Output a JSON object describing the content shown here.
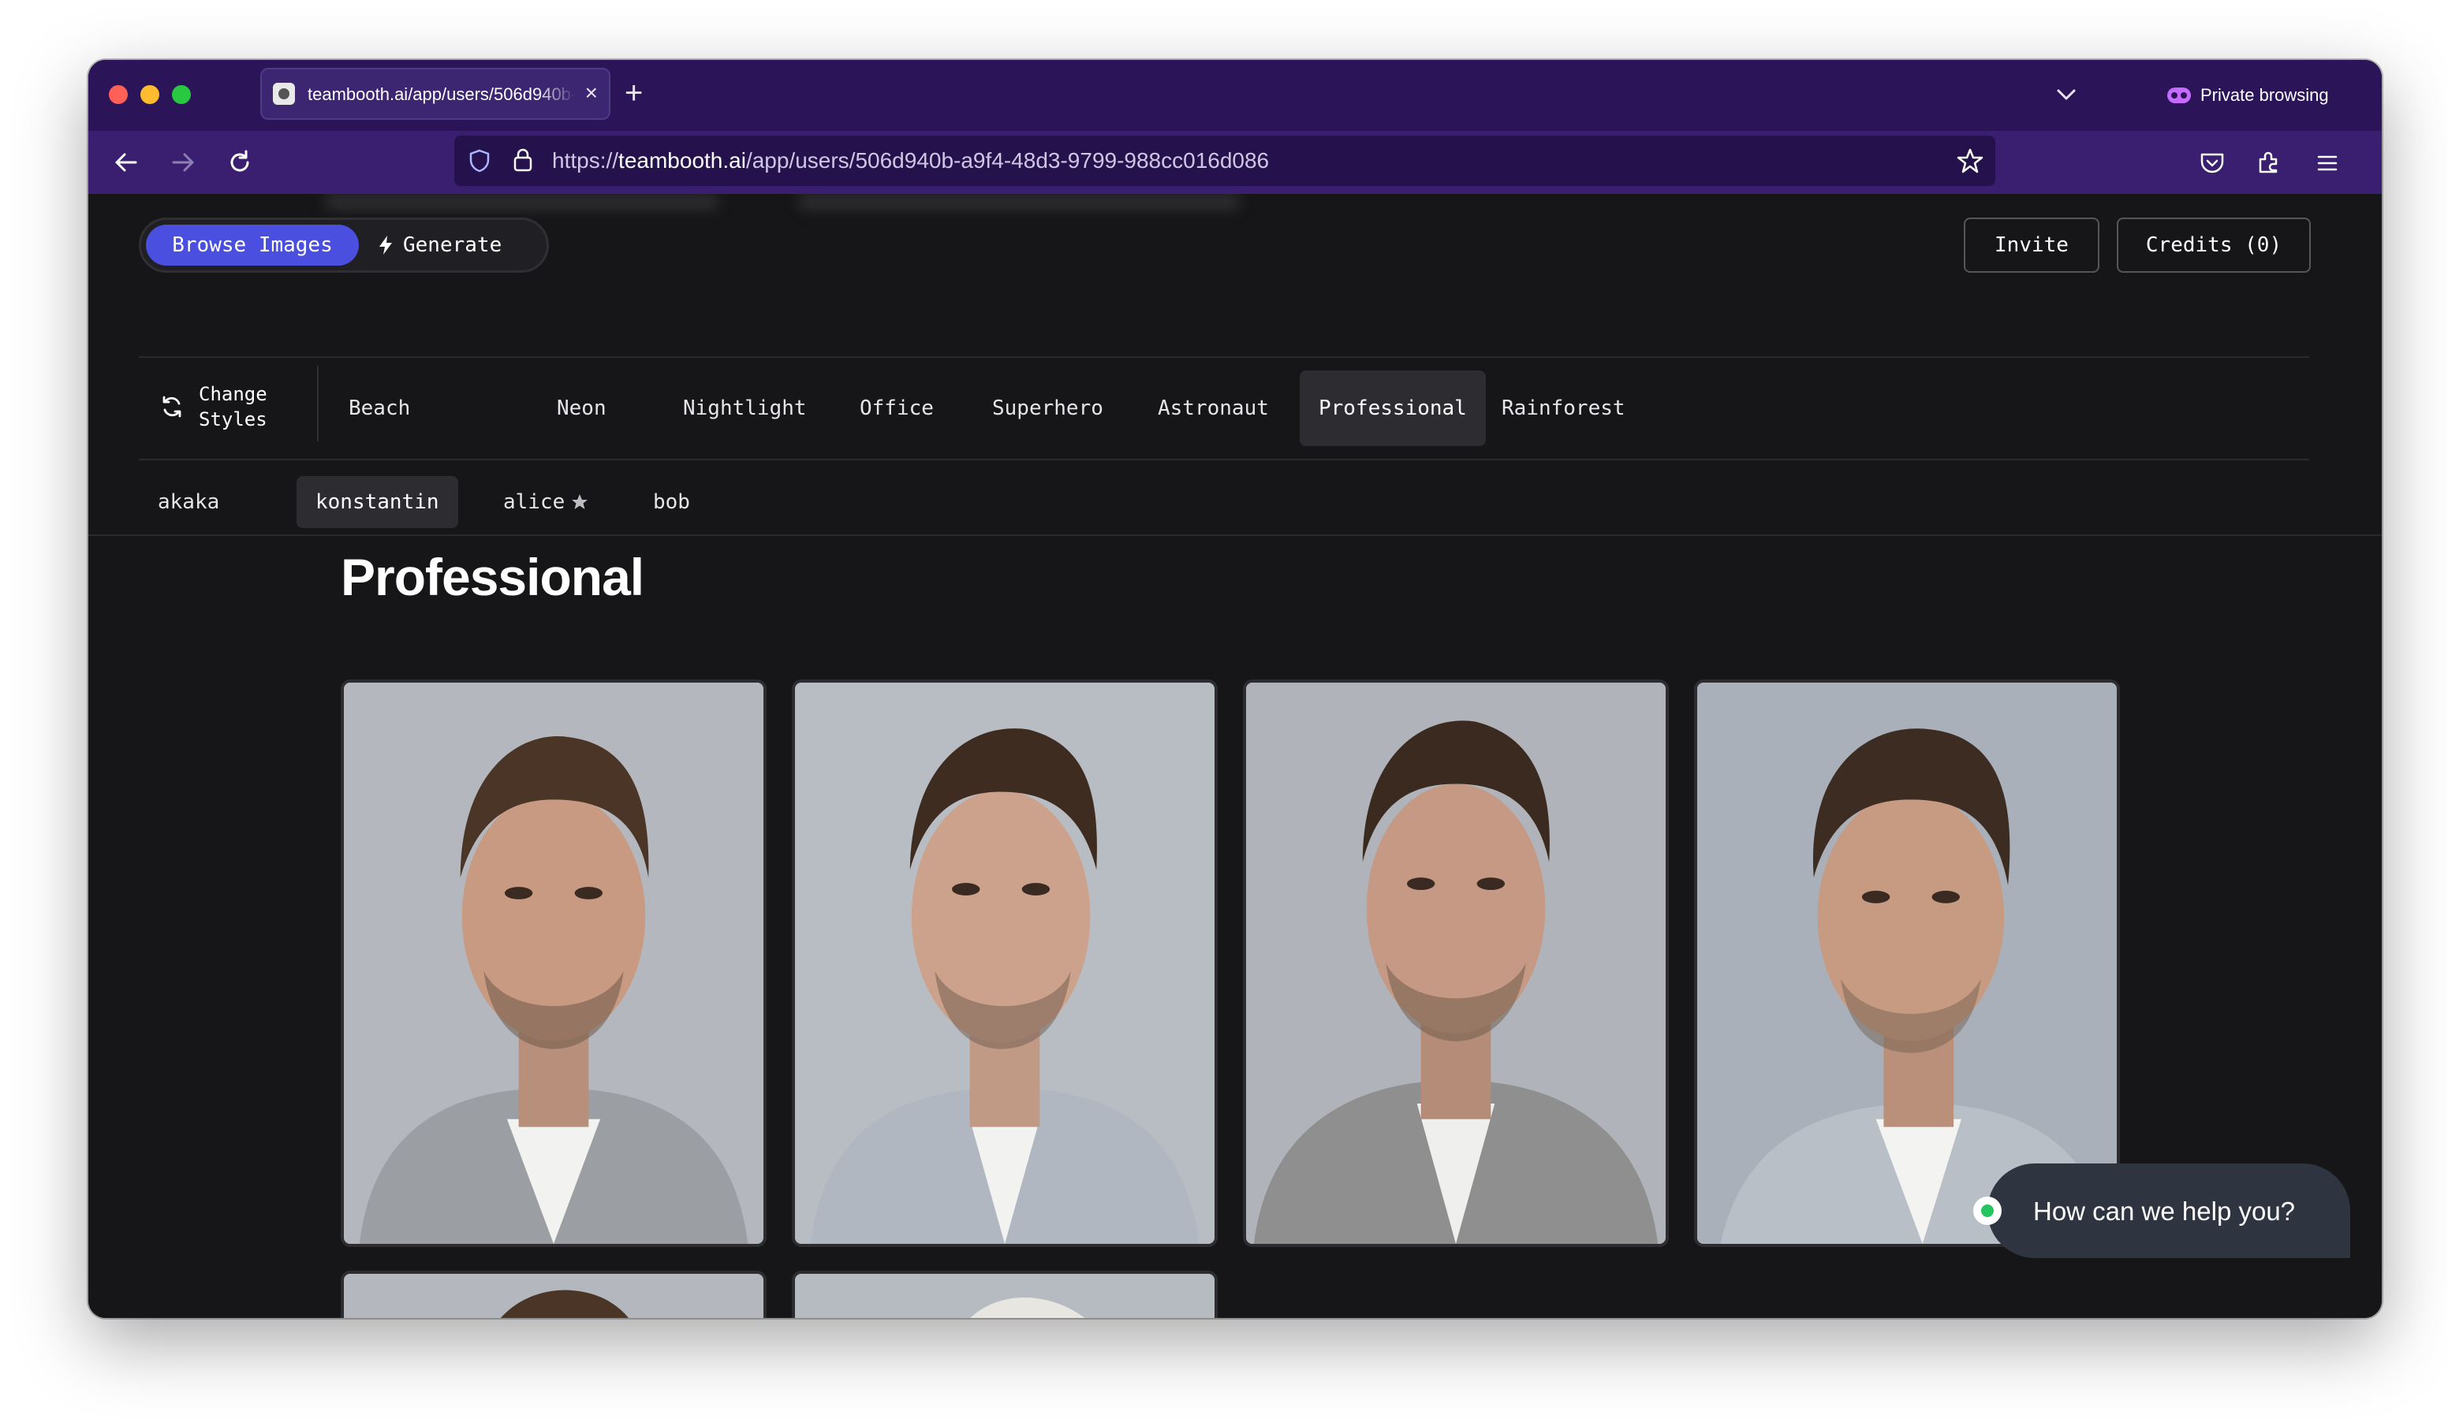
{
  "browser": {
    "tab_title": "teambooth.ai/app/users/506d940b-a9f4-48d3-9799-988cc016d086",
    "private_label": "Private browsing",
    "url_scheme": "https://",
    "url_host": "teambooth.ai",
    "url_path": "/app/users/506d940b-a9f4-48d3-9799-988cc016d086"
  },
  "toolbar": {
    "browse_label": "Browse Images",
    "generate_label": "Generate",
    "invite_label": "Invite",
    "credits_label": "Credits (0)"
  },
  "styles": {
    "change_label_line1": "Change",
    "change_label_line2": "Styles",
    "items": [
      "Beach",
      "Neon",
      "Nightlight",
      "Office",
      "Superhero",
      "Astronaut",
      "Professional",
      "Rainforest"
    ],
    "active": "Professional"
  },
  "users": {
    "items": [
      "akaka",
      "konstantin",
      "alice",
      "bob"
    ],
    "active": "konstantin",
    "starred": "alice"
  },
  "main": {
    "title": "Professional"
  },
  "chat": {
    "prompt": "How can we help you?"
  },
  "colors": {
    "accent": "#4a4fe0",
    "tabbar": "#2b1458",
    "navbar": "#3a1f70",
    "page_bg": "#161618",
    "online": "#22c55e"
  }
}
